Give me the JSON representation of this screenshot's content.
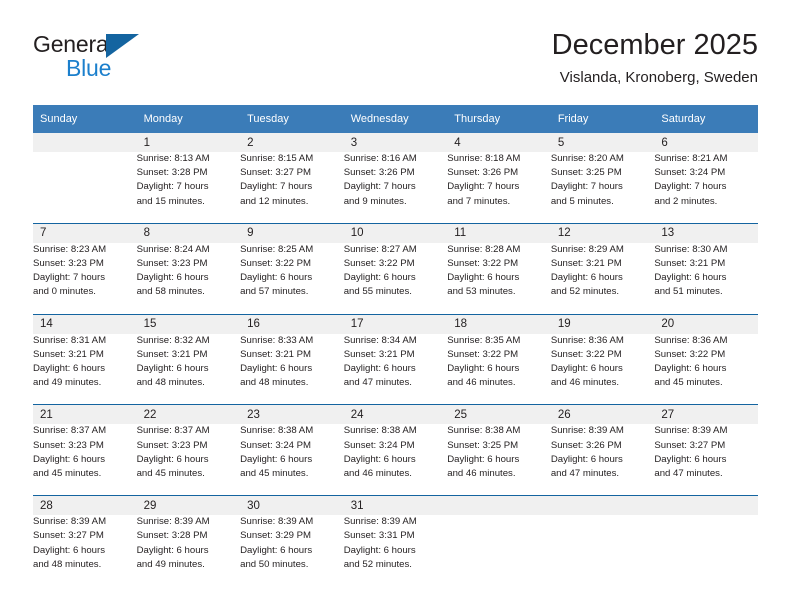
{
  "brand": {
    "name_part1": "General",
    "name_part2": "Blue"
  },
  "header": {
    "title": "December 2025",
    "subtitle": "Vislanda, Kronoberg, Sweden"
  },
  "colors": {
    "header_blue": "#3b7cb8",
    "rule_blue": "#1464a0",
    "band_gray": "#f0f0f0",
    "brand_blue": "#1b7fcc",
    "text": "#231f20"
  },
  "weekday_headers": [
    "Sunday",
    "Monday",
    "Tuesday",
    "Wednesday",
    "Thursday",
    "Friday",
    "Saturday"
  ],
  "weeks": [
    {
      "days": [
        {
          "num": "",
          "line1": "",
          "line2": "",
          "line3": "",
          "line4": ""
        },
        {
          "num": "1",
          "line1": "Sunrise: 8:13 AM",
          "line2": "Sunset: 3:28 PM",
          "line3": "Daylight: 7 hours",
          "line4": "and 15 minutes."
        },
        {
          "num": "2",
          "line1": "Sunrise: 8:15 AM",
          "line2": "Sunset: 3:27 PM",
          "line3": "Daylight: 7 hours",
          "line4": "and 12 minutes."
        },
        {
          "num": "3",
          "line1": "Sunrise: 8:16 AM",
          "line2": "Sunset: 3:26 PM",
          "line3": "Daylight: 7 hours",
          "line4": "and 9 minutes."
        },
        {
          "num": "4",
          "line1": "Sunrise: 8:18 AM",
          "line2": "Sunset: 3:26 PM",
          "line3": "Daylight: 7 hours",
          "line4": "and 7 minutes."
        },
        {
          "num": "5",
          "line1": "Sunrise: 8:20 AM",
          "line2": "Sunset: 3:25 PM",
          "line3": "Daylight: 7 hours",
          "line4": "and 5 minutes."
        },
        {
          "num": "6",
          "line1": "Sunrise: 8:21 AM",
          "line2": "Sunset: 3:24 PM",
          "line3": "Daylight: 7 hours",
          "line4": "and 2 minutes."
        }
      ]
    },
    {
      "days": [
        {
          "num": "7",
          "line1": "Sunrise: 8:23 AM",
          "line2": "Sunset: 3:23 PM",
          "line3": "Daylight: 7 hours",
          "line4": "and 0 minutes."
        },
        {
          "num": "8",
          "line1": "Sunrise: 8:24 AM",
          "line2": "Sunset: 3:23 PM",
          "line3": "Daylight: 6 hours",
          "line4": "and 58 minutes."
        },
        {
          "num": "9",
          "line1": "Sunrise: 8:25 AM",
          "line2": "Sunset: 3:22 PM",
          "line3": "Daylight: 6 hours",
          "line4": "and 57 minutes."
        },
        {
          "num": "10",
          "line1": "Sunrise: 8:27 AM",
          "line2": "Sunset: 3:22 PM",
          "line3": "Daylight: 6 hours",
          "line4": "and 55 minutes."
        },
        {
          "num": "11",
          "line1": "Sunrise: 8:28 AM",
          "line2": "Sunset: 3:22 PM",
          "line3": "Daylight: 6 hours",
          "line4": "and 53 minutes."
        },
        {
          "num": "12",
          "line1": "Sunrise: 8:29 AM",
          "line2": "Sunset: 3:21 PM",
          "line3": "Daylight: 6 hours",
          "line4": "and 52 minutes."
        },
        {
          "num": "13",
          "line1": "Sunrise: 8:30 AM",
          "line2": "Sunset: 3:21 PM",
          "line3": "Daylight: 6 hours",
          "line4": "and 51 minutes."
        }
      ]
    },
    {
      "days": [
        {
          "num": "14",
          "line1": "Sunrise: 8:31 AM",
          "line2": "Sunset: 3:21 PM",
          "line3": "Daylight: 6 hours",
          "line4": "and 49 minutes."
        },
        {
          "num": "15",
          "line1": "Sunrise: 8:32 AM",
          "line2": "Sunset: 3:21 PM",
          "line3": "Daylight: 6 hours",
          "line4": "and 48 minutes."
        },
        {
          "num": "16",
          "line1": "Sunrise: 8:33 AM",
          "line2": "Sunset: 3:21 PM",
          "line3": "Daylight: 6 hours",
          "line4": "and 48 minutes."
        },
        {
          "num": "17",
          "line1": "Sunrise: 8:34 AM",
          "line2": "Sunset: 3:21 PM",
          "line3": "Daylight: 6 hours",
          "line4": "and 47 minutes."
        },
        {
          "num": "18",
          "line1": "Sunrise: 8:35 AM",
          "line2": "Sunset: 3:22 PM",
          "line3": "Daylight: 6 hours",
          "line4": "and 46 minutes."
        },
        {
          "num": "19",
          "line1": "Sunrise: 8:36 AM",
          "line2": "Sunset: 3:22 PM",
          "line3": "Daylight: 6 hours",
          "line4": "and 46 minutes."
        },
        {
          "num": "20",
          "line1": "Sunrise: 8:36 AM",
          "line2": "Sunset: 3:22 PM",
          "line3": "Daylight: 6 hours",
          "line4": "and 45 minutes."
        }
      ]
    },
    {
      "days": [
        {
          "num": "21",
          "line1": "Sunrise: 8:37 AM",
          "line2": "Sunset: 3:23 PM",
          "line3": "Daylight: 6 hours",
          "line4": "and 45 minutes."
        },
        {
          "num": "22",
          "line1": "Sunrise: 8:37 AM",
          "line2": "Sunset: 3:23 PM",
          "line3": "Daylight: 6 hours",
          "line4": "and 45 minutes."
        },
        {
          "num": "23",
          "line1": "Sunrise: 8:38 AM",
          "line2": "Sunset: 3:24 PM",
          "line3": "Daylight: 6 hours",
          "line4": "and 45 minutes."
        },
        {
          "num": "24",
          "line1": "Sunrise: 8:38 AM",
          "line2": "Sunset: 3:24 PM",
          "line3": "Daylight: 6 hours",
          "line4": "and 46 minutes."
        },
        {
          "num": "25",
          "line1": "Sunrise: 8:38 AM",
          "line2": "Sunset: 3:25 PM",
          "line3": "Daylight: 6 hours",
          "line4": "and 46 minutes."
        },
        {
          "num": "26",
          "line1": "Sunrise: 8:39 AM",
          "line2": "Sunset: 3:26 PM",
          "line3": "Daylight: 6 hours",
          "line4": "and 47 minutes."
        },
        {
          "num": "27",
          "line1": "Sunrise: 8:39 AM",
          "line2": "Sunset: 3:27 PM",
          "line3": "Daylight: 6 hours",
          "line4": "and 47 minutes."
        }
      ]
    },
    {
      "days": [
        {
          "num": "28",
          "line1": "Sunrise: 8:39 AM",
          "line2": "Sunset: 3:27 PM",
          "line3": "Daylight: 6 hours",
          "line4": "and 48 minutes."
        },
        {
          "num": "29",
          "line1": "Sunrise: 8:39 AM",
          "line2": "Sunset: 3:28 PM",
          "line3": "Daylight: 6 hours",
          "line4": "and 49 minutes."
        },
        {
          "num": "30",
          "line1": "Sunrise: 8:39 AM",
          "line2": "Sunset: 3:29 PM",
          "line3": "Daylight: 6 hours",
          "line4": "and 50 minutes."
        },
        {
          "num": "31",
          "line1": "Sunrise: 8:39 AM",
          "line2": "Sunset: 3:31 PM",
          "line3": "Daylight: 6 hours",
          "line4": "and 52 minutes."
        },
        {
          "num": "",
          "line1": "",
          "line2": "",
          "line3": "",
          "line4": ""
        },
        {
          "num": "",
          "line1": "",
          "line2": "",
          "line3": "",
          "line4": ""
        },
        {
          "num": "",
          "line1": "",
          "line2": "",
          "line3": "",
          "line4": ""
        }
      ]
    }
  ]
}
